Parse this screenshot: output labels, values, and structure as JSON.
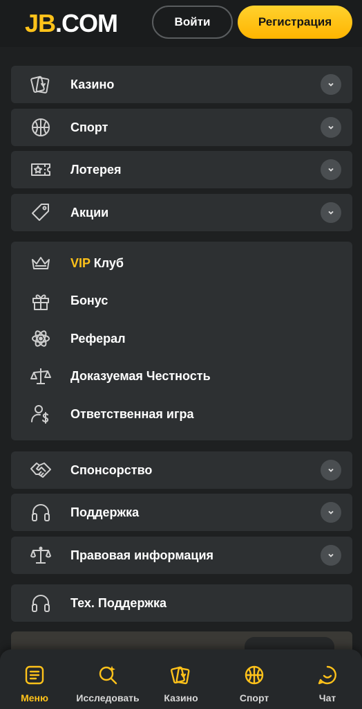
{
  "header": {
    "logo_jb": "JB",
    "logo_com": ".COM",
    "login_label": "Войти",
    "register_label": "Регистрация"
  },
  "menu": {
    "casino": "Казино",
    "sport": "Спорт",
    "lottery": "Лотерея",
    "promotions": "Акции",
    "vip_prefix": "VIP",
    "vip_suffix": " Клуб",
    "bonus": "Бонус",
    "referral": "Реферал",
    "provable_fairness": "Доказуемая Честность",
    "responsible_gaming": "Ответственная игра",
    "sponsorship": "Спонсорство",
    "support": "Поддержка",
    "legal": "Правовая информация",
    "tech_support": "Тех. Поддержка"
  },
  "bottom_nav": {
    "menu": "Меню",
    "explore": "Исследовать",
    "casino": "Казино",
    "sport": "Спорт",
    "chat": "Чат"
  },
  "colors": {
    "accent": "#ffc21a",
    "background": "#1e2021",
    "card": "#2d3032",
    "chevron_bg": "#4a4e51"
  },
  "icons": [
    "cards-icon",
    "basketball-icon",
    "ticket-icon",
    "tag-icon",
    "crown-icon",
    "gift-icon",
    "atom-icon",
    "scales-icon",
    "user-dollar-icon",
    "handshake-icon",
    "headset-icon",
    "balance-icon",
    "menu-icon",
    "search-icon",
    "chevron-down-icon",
    "chat-icon"
  ]
}
